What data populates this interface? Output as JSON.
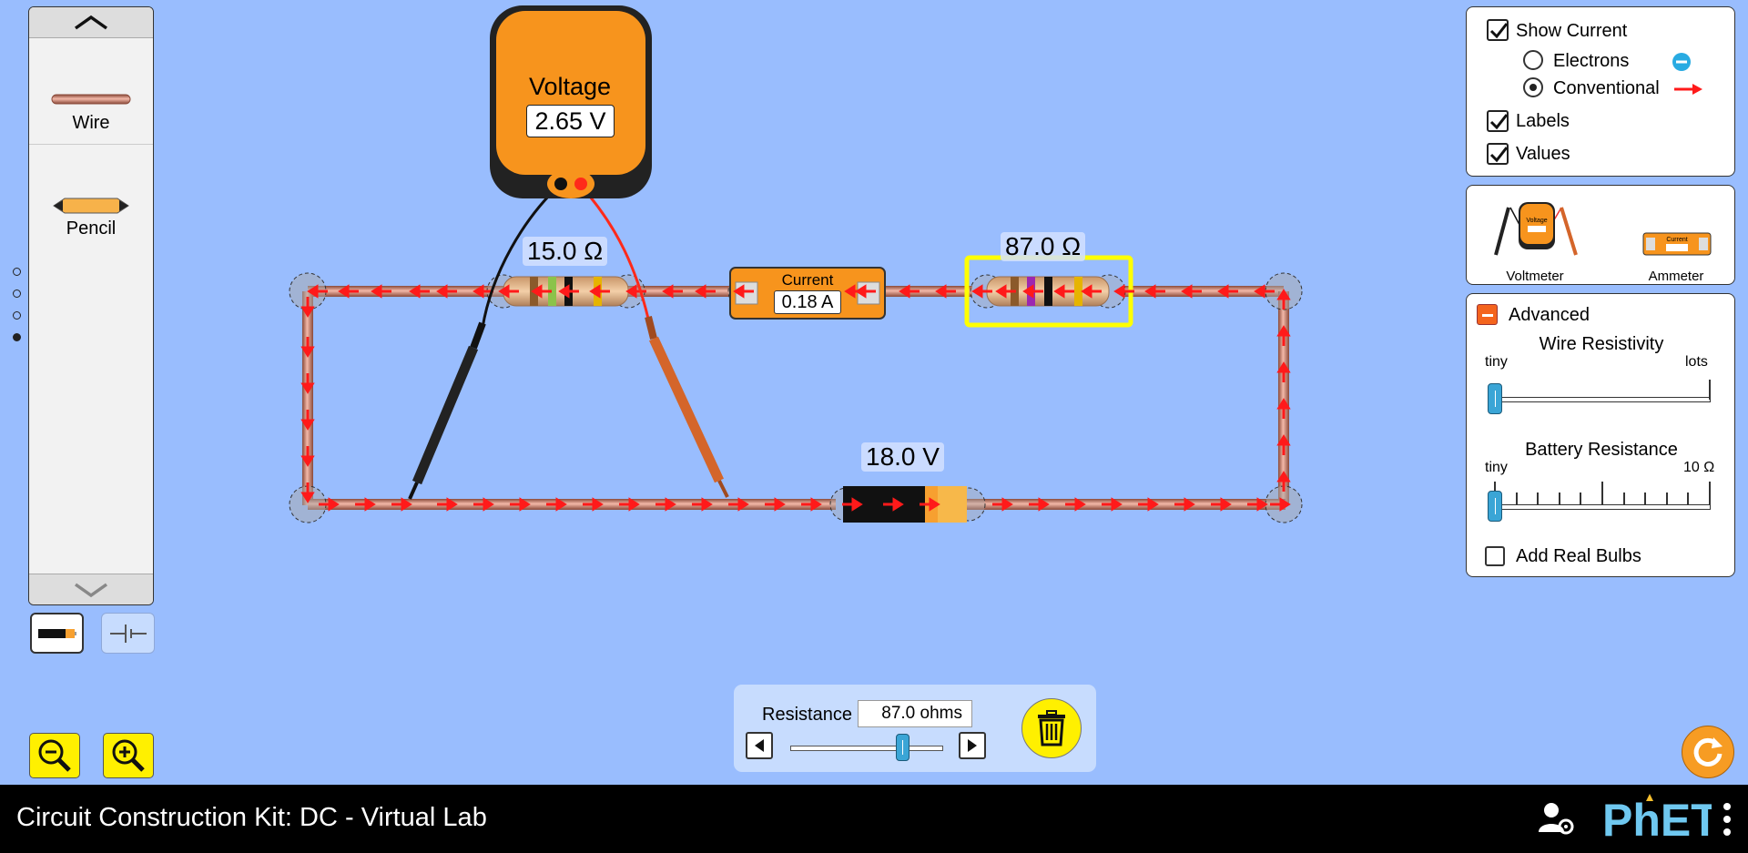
{
  "toolbox": {
    "items": [
      {
        "label": "Wire",
        "icon": "wire-icon"
      },
      {
        "label": "Pencil",
        "icon": "pencil-icon"
      }
    ]
  },
  "meter": {
    "title": "Voltage",
    "reading": "2.65 V"
  },
  "circuit": {
    "resistor_left_label": "15.0 Ω",
    "resistor_right_label": "87.0 Ω",
    "battery_label": "18.0 V",
    "ammeter_title": "Current",
    "ammeter_reading": "0.18 A"
  },
  "display_panel": {
    "show_current": "Show Current",
    "electrons": "Electrons",
    "conventional": "Conventional",
    "labels": "Labels",
    "values": "Values"
  },
  "sensors_panel": {
    "voltmeter": "Voltmeter",
    "ammeter": "Ammeter",
    "voltmeter_icon_text": "Voltage",
    "ammeter_icon_text": "Current"
  },
  "advanced_panel": {
    "title": "Advanced",
    "wire_resistivity": "Wire Resistivity",
    "wire_min": "tiny",
    "wire_max": "lots",
    "battery_resistance": "Battery Resistance",
    "battery_min": "tiny",
    "battery_max": "10 Ω",
    "add_real_bulbs": "Add Real Bulbs"
  },
  "resistance_control": {
    "label": "Resistance",
    "value": "87.0 ohms",
    "slider_level": 0.73
  },
  "navbar": {
    "title": "Circuit Construction Kit: DC - Virtual Lab",
    "brand": "PhET"
  },
  "colors": {
    "background": "#99bdfe",
    "accent": "#f79c23",
    "highlight": "#ffff00",
    "current_arrow": "#ff0000"
  }
}
